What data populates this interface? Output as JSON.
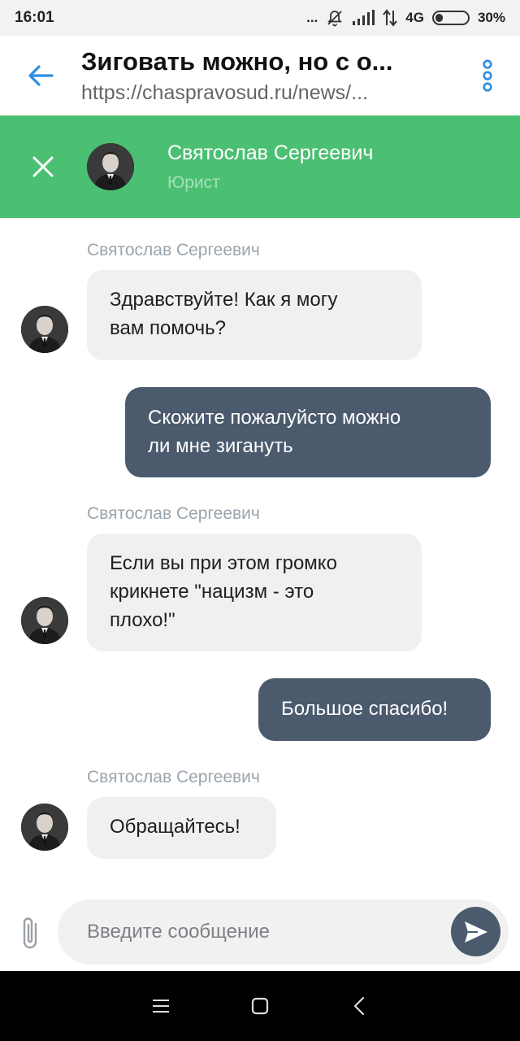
{
  "status_bar": {
    "time": "16:01",
    "dots": "...",
    "network": "4G",
    "battery_text": "30%",
    "battery_level": 0.3,
    "icons": [
      "mute-icon",
      "signal-icon",
      "data-arrows-icon",
      "battery-icon"
    ]
  },
  "browser": {
    "title": "Зиговать можно, но с о...",
    "url": "https://chaspravosud.ru/news/...",
    "back_icon": "arrow-left-icon",
    "menu_icon": "kebab-menu-icon"
  },
  "chat_header": {
    "name": "Святослав Сергеевич",
    "role": "Юрист",
    "close_icon": "close-icon",
    "accent": "#4bbf72"
  },
  "messages": [
    {
      "direction": "in",
      "sender": "Святослав Сергеевич",
      "lines": [
        "Здравствуйте! Как я могу",
        "вам помочь?"
      ]
    },
    {
      "direction": "out",
      "lines": [
        "Скожите пожалуйсто можно",
        "ли мне зигануть"
      ]
    },
    {
      "direction": "in",
      "sender": "Святослав Сергеевич",
      "lines": [
        "Если вы при этом громко",
        "крикнете \"нацизм - это",
        "плохо!\""
      ]
    },
    {
      "direction": "out",
      "lines": [
        "Большое спасибо!"
      ]
    },
    {
      "direction": "in",
      "sender": "Святослав Сергеевич",
      "lines": [
        "Обращайтесь!"
      ]
    }
  ],
  "composer": {
    "placeholder": "Введите сообщение",
    "attach_icon": "paperclip-icon",
    "send_icon": "send-icon"
  },
  "colors": {
    "outgoing_bubble": "#4b5a6d",
    "incoming_bubble": "#f0f0f0",
    "link_blue": "#2d8ee0"
  },
  "nav_bar": {
    "icons": [
      "menu-icon",
      "home-square-icon",
      "back-chevron-icon"
    ]
  }
}
